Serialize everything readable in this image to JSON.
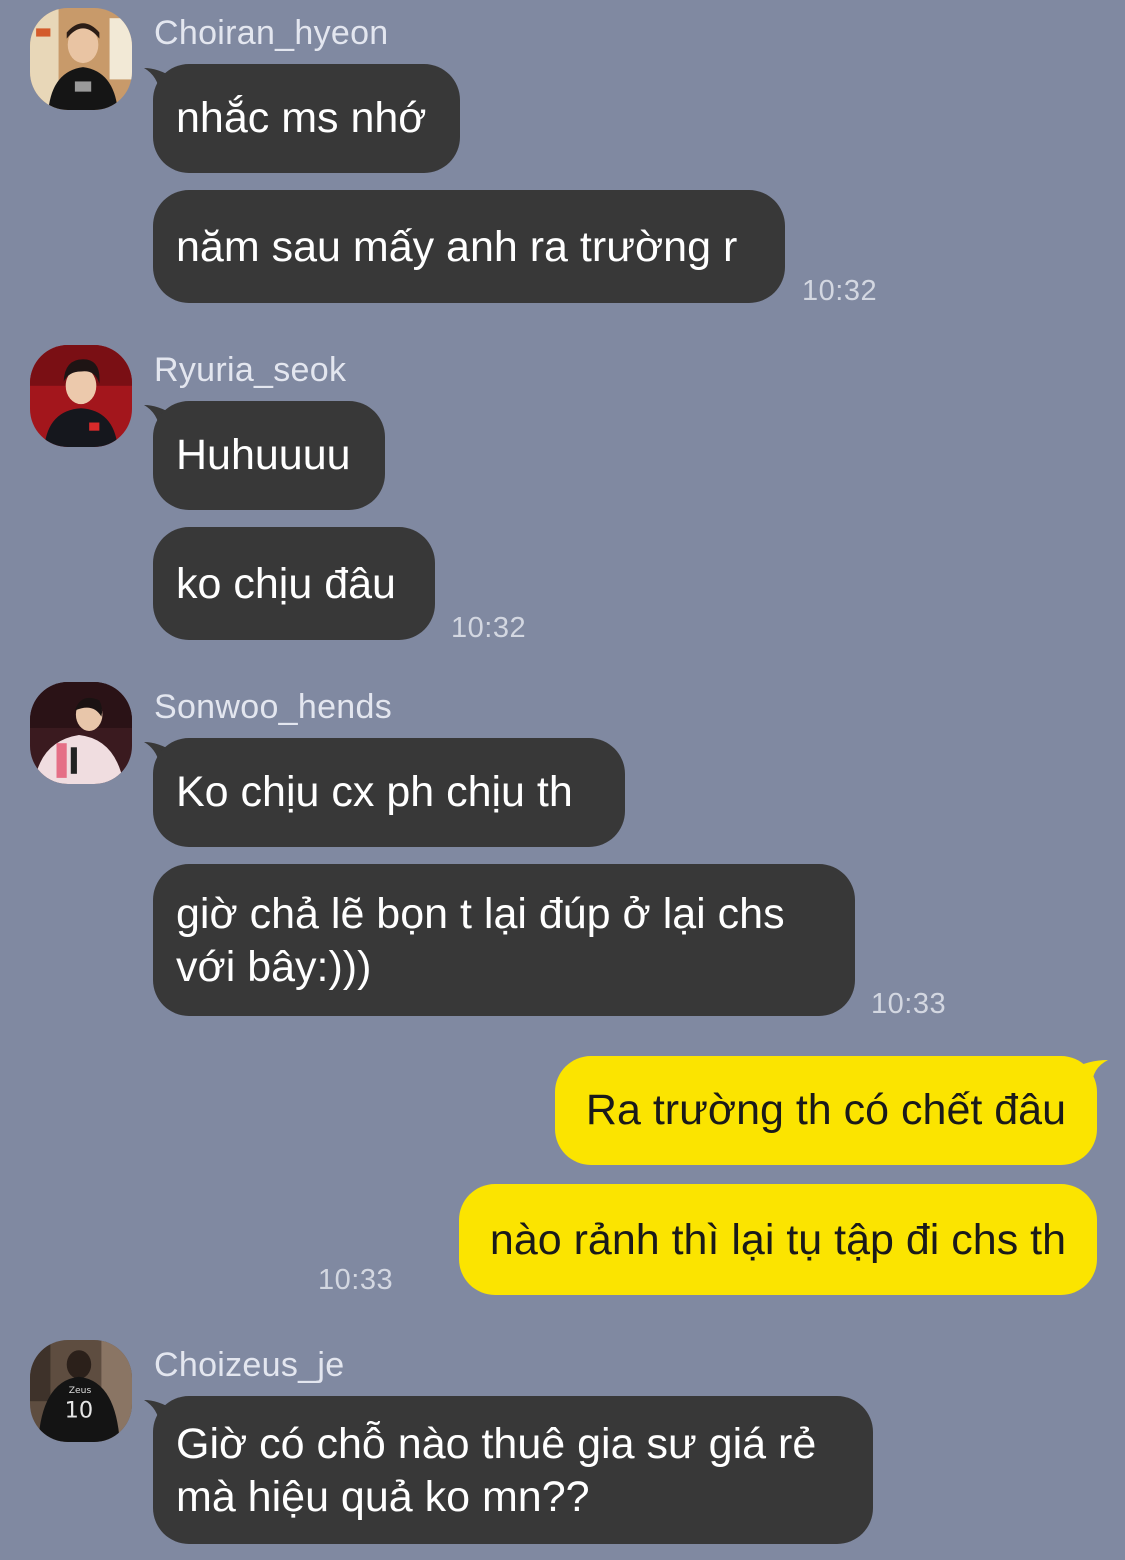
{
  "colors": {
    "background": "#8089a1",
    "incoming_bubble": "#383838",
    "outgoing_bubble": "#fbe400",
    "sender_text": "#e3e6ef",
    "time_text": "#d3d7e1"
  },
  "groups": [
    {
      "sender": "Choiran_hyeon",
      "avatar_icon": "avatar-photo-choiran-icon",
      "messages": [
        "nhắc ms nhớ",
        "năm sau mấy anh ra trường r"
      ],
      "time": "10:32"
    },
    {
      "sender": "Ryuria_seok",
      "avatar_icon": "avatar-photo-ryuria-icon",
      "messages": [
        "Huhuuuu",
        "ko chịu đâu"
      ],
      "time": "10:32"
    },
    {
      "sender": "Sonwoo_hends",
      "avatar_icon": "avatar-photo-sonwoo-icon",
      "messages": [
        "Ko chịu cx ph chịu th",
        "giờ chả lẽ bọn t lại đúp ở lại chs",
        "với bây:)))"
      ],
      "time": "10:33"
    },
    {
      "sender": "me",
      "messages": [
        "Ra trường th có chết đâu",
        "nào rảnh thì lại tụ tập đi chs th"
      ],
      "time": "10:33"
    },
    {
      "sender": "Choizeus_je",
      "avatar_icon": "avatar-photo-choizeus-icon",
      "messages": [
        "Giờ có chỗ nào thuê gia sư giá rẻ",
        "mà hiệu quả ko mn??"
      ]
    }
  ]
}
